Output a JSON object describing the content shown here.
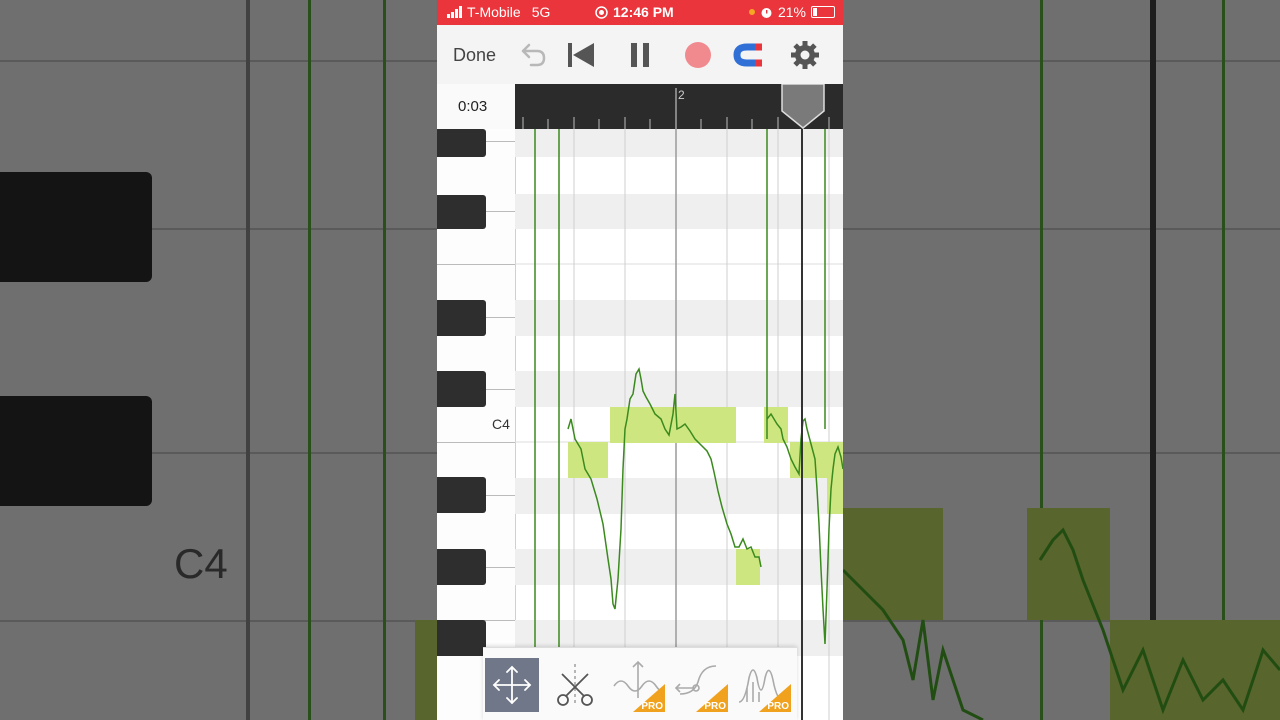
{
  "status": {
    "carrier": "T-Mobile",
    "network": "5G",
    "time": "12:46 PM",
    "battery": "21%"
  },
  "toolbar": {
    "done_label": "Done",
    "buttons": [
      "undo-icon",
      "skip-to-start-icon",
      "pause-icon",
      "record-icon",
      "snap-magnet-icon",
      "settings-gear-icon"
    ],
    "record_color": "#f08a8f",
    "magnet_color": "#2f6fd6"
  },
  "timeline": {
    "current_time": "0:03",
    "bar_marker": "2"
  },
  "piano_roll": {
    "note_label": "C4",
    "note_color": "#cde680",
    "pitch_line_color": "#3a8a1e"
  },
  "tools": {
    "items": [
      {
        "name": "move-tool",
        "pro": false,
        "selected": true
      },
      {
        "name": "scissors-tool",
        "pro": false,
        "selected": false
      },
      {
        "name": "pitch-modulation-tool",
        "pro": true,
        "selected": false
      },
      {
        "name": "pitch-drift-tool",
        "pro": true,
        "selected": false
      },
      {
        "name": "formant-tool",
        "pro": true,
        "selected": false
      }
    ],
    "pro_label": "PRO"
  },
  "background": {
    "note_label": "C4"
  }
}
